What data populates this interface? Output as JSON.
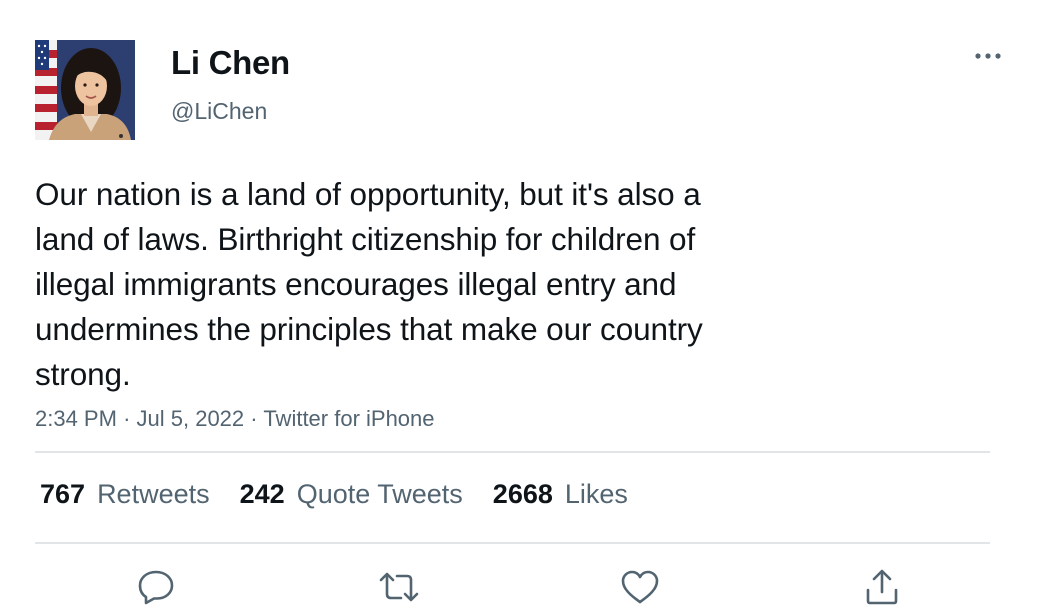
{
  "tweet": {
    "author": {
      "display_name": "Li Chen",
      "handle": "@LiChen",
      "avatar_icon": "profile-photo"
    },
    "text": "Our nation is a land of opportunity, but it's also a\nland of laws. Birthright citizenship for children of\nillegal immigrants encourages illegal entry and\nundermines the principles that make our country\nstrong.",
    "time": "2:34 PM",
    "date": "Jul 5, 2022",
    "source": "Twitter for iPhone",
    "separator": "·"
  },
  "stats": {
    "retweets": {
      "count": "767",
      "label": "Retweets"
    },
    "quote_tweets": {
      "count": "242",
      "label": "Quote Tweets"
    },
    "likes": {
      "count": "2668",
      "label": "Likes"
    }
  },
  "actions": {
    "reply_icon": "speech-bubble-icon",
    "retweet_icon": "retweet-arrows-icon",
    "like_icon": "heart-icon",
    "share_icon": "share-upload-icon",
    "more_icon": "ellipsis-icon"
  },
  "colors": {
    "text_primary": "#0f1419",
    "text_secondary": "#536471",
    "divider": "#e1e5e8"
  }
}
